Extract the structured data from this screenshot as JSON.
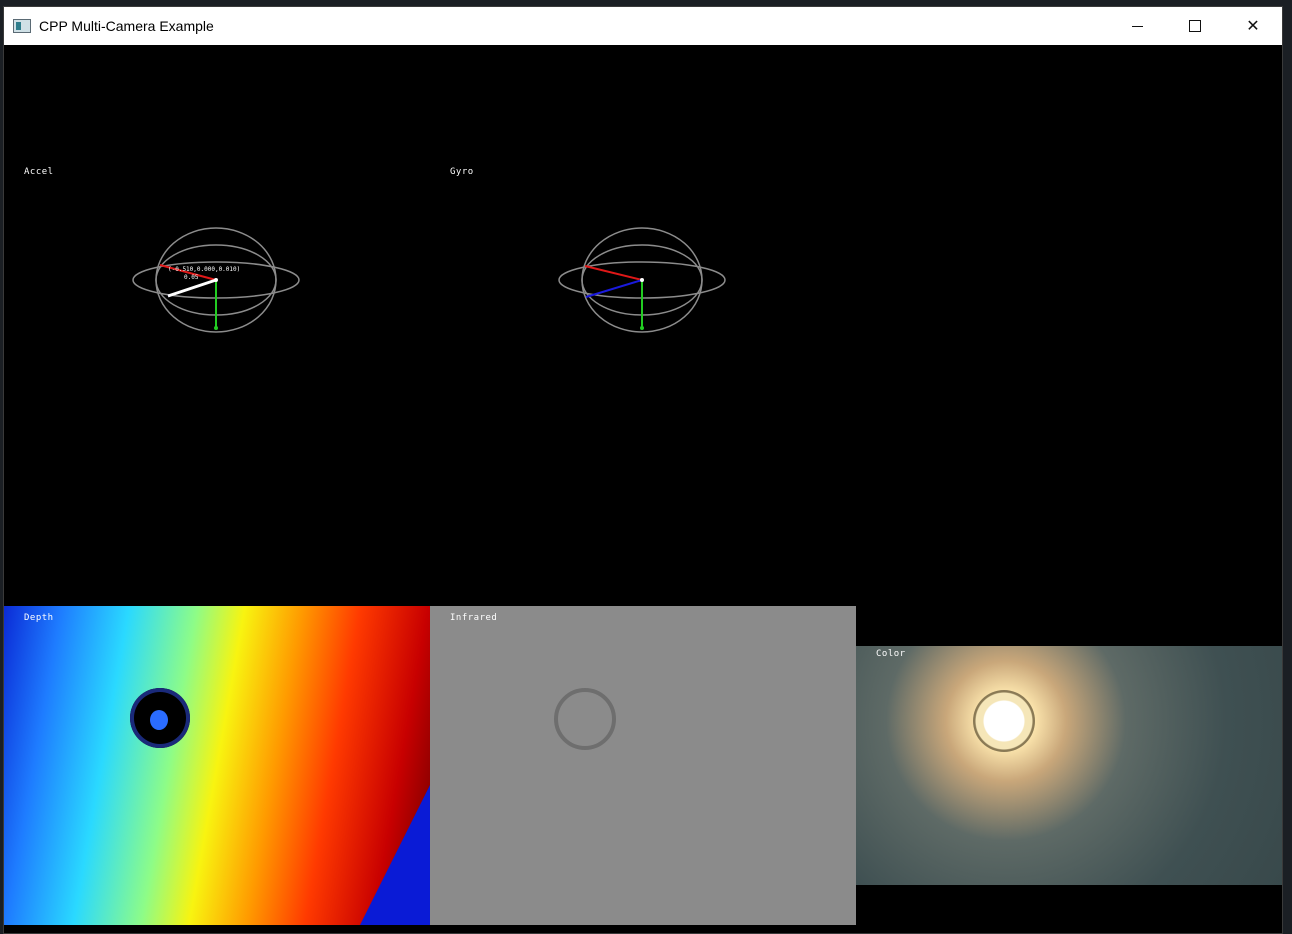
{
  "window": {
    "title": "CPP Multi-Camera Example",
    "buttons": [
      "minimize",
      "maximize",
      "close"
    ],
    "close_glyph": "✕"
  },
  "panels": {
    "accel": {
      "label": "Accel",
      "reading": "(-0.510,0.000,0.010)",
      "magnitude": "0.05"
    },
    "gyro": {
      "label": "Gyro"
    },
    "depth": {
      "label": "Depth"
    },
    "infrared": {
      "label": "Infrared"
    },
    "color": {
      "label": "Color"
    }
  },
  "colors": {
    "x_axis": "#e01818",
    "y_axis": "#22cc22",
    "z_axis": "#1a1add",
    "vector": "#ffffff",
    "sphere": "#8c8c8c"
  }
}
